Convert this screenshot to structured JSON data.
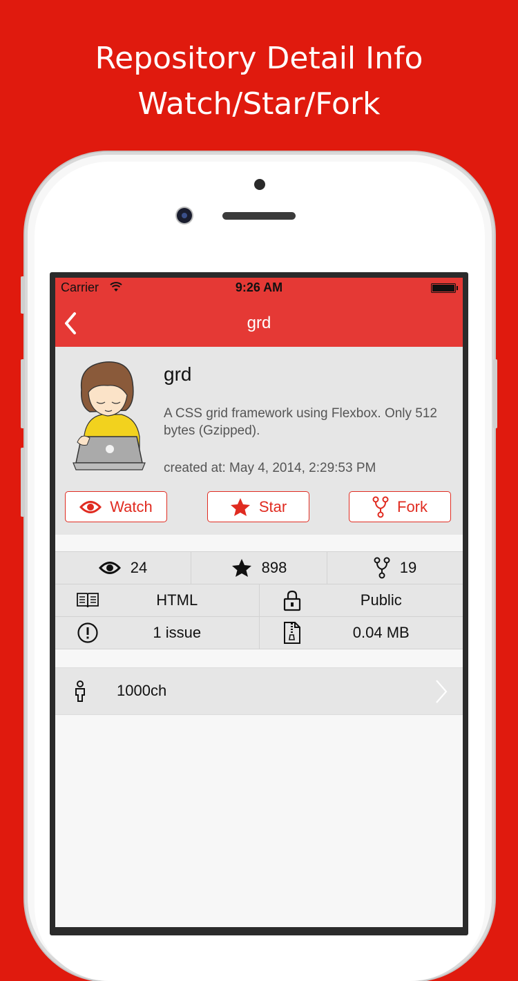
{
  "headline": {
    "line1": "Repository Detail Info",
    "line2": "Watch/Star/Fork"
  },
  "status_bar": {
    "carrier": "Carrier",
    "time": "9:26 AM"
  },
  "nav": {
    "title": "grd",
    "back_icon": "chevron-left-icon"
  },
  "repo": {
    "name": "grd",
    "description": "A CSS grid framework using Flexbox. Only 512 bytes (Gzipped).",
    "created_at": "created at: May 4, 2014, 2:29:53 PM"
  },
  "actions": {
    "watch": {
      "label": "Watch",
      "icon": "eye-icon"
    },
    "star": {
      "label": "Star",
      "icon": "star-icon"
    },
    "fork": {
      "label": "Fork",
      "icon": "fork-icon"
    }
  },
  "stats": {
    "watchers": "24",
    "stars": "898",
    "forks": "19",
    "language": "HTML",
    "visibility": "Public",
    "issues": "1 issue",
    "size": "0.04 MB"
  },
  "owner": {
    "name": "1000ch"
  },
  "colors": {
    "background": "#e01a0e",
    "nav_bar": "#e53935",
    "accent": "#e02b20",
    "panel": "#e6e6e6"
  }
}
